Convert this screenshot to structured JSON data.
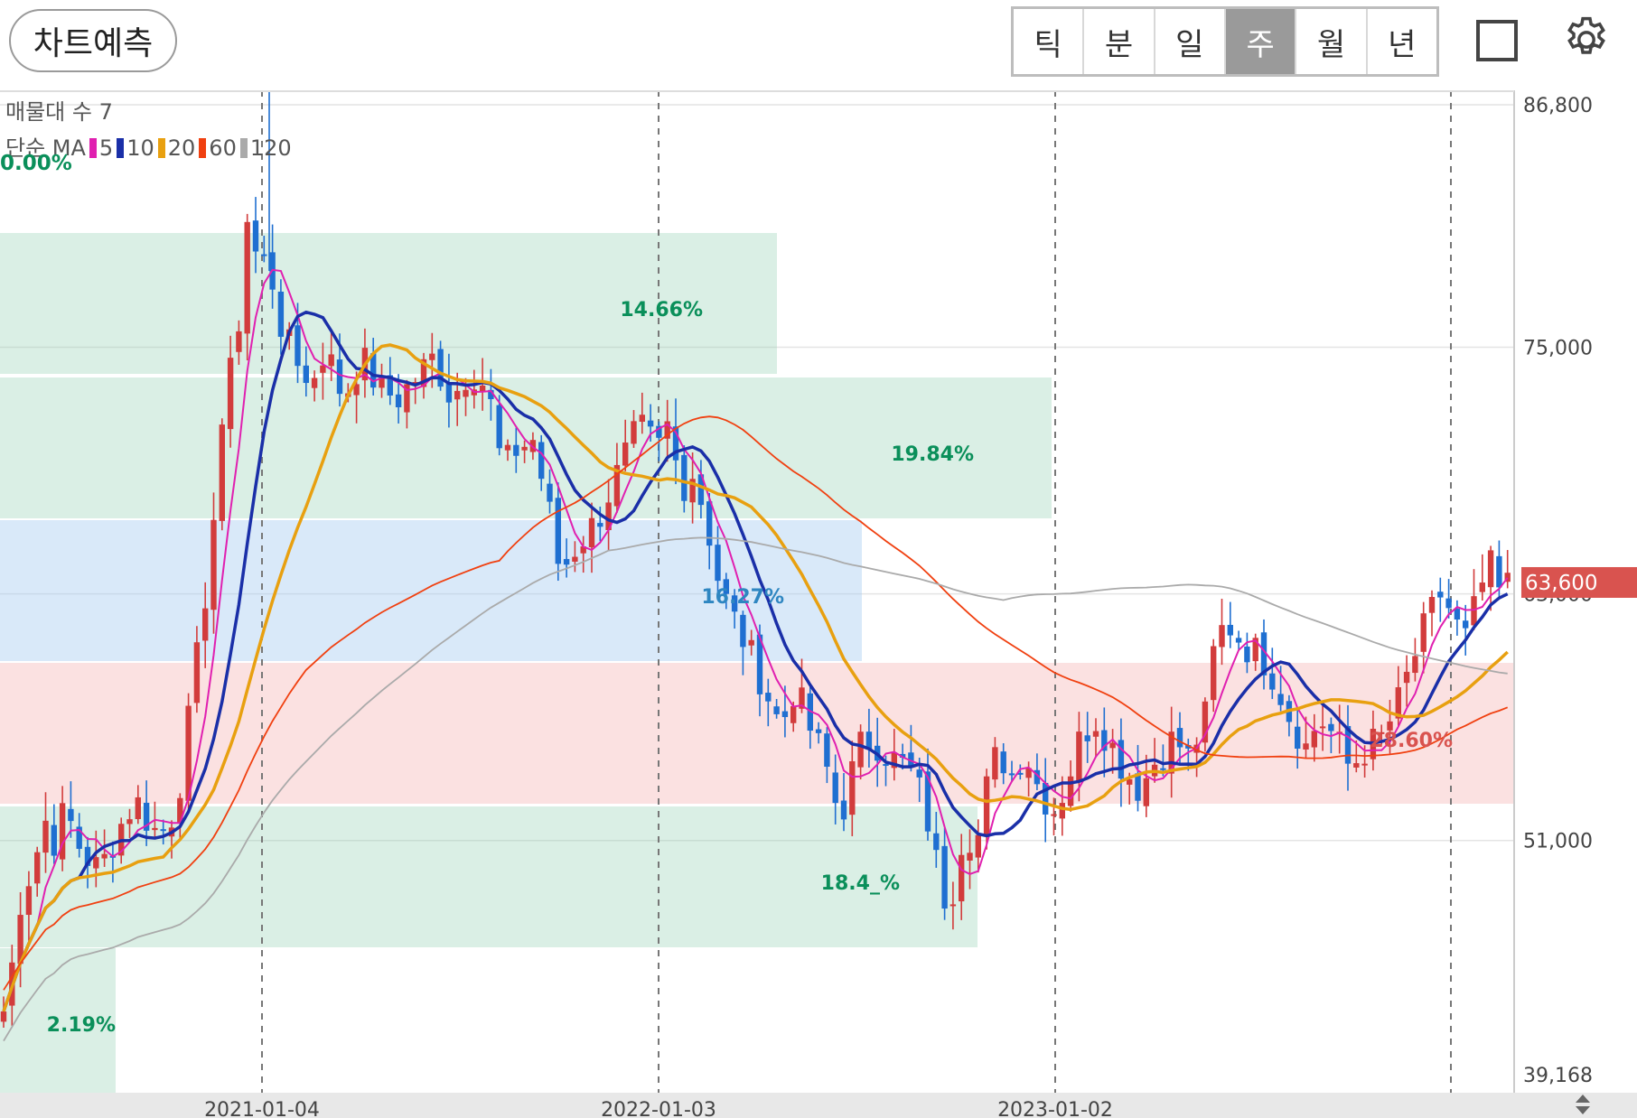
{
  "toolbar": {
    "forecast_label": "차트예측",
    "periods": [
      "틱",
      "분",
      "일",
      "주",
      "월",
      "년"
    ],
    "active_period": "주",
    "icons": [
      "square-icon",
      "gear-icon"
    ]
  },
  "legend": {
    "volume_profile": "매물대 수 7",
    "ma_label": "단순 MA",
    "ma_periods": [
      {
        "label": "5",
        "color": "#e020b0"
      },
      {
        "label": "10",
        "color": "#1a2fa8"
      },
      {
        "label": "20",
        "color": "#e8a010"
      },
      {
        "label": "60",
        "color": "#f04010"
      },
      {
        "label": "120",
        "color": "#aaaaaa"
      }
    ],
    "base_pct": "0.00%"
  },
  "axis": {
    "y_labels": [
      "86,800",
      "75,000",
      "63,000",
      "51,000",
      "39,168"
    ],
    "x_labels": [
      "2021-01-04",
      "2022-01-03",
      "2023-01-02"
    ],
    "current_price": "63,600",
    "current_price_color": "#d9534f"
  },
  "zones": [
    {
      "label": "14.66%",
      "color": "#0a8f5a"
    },
    {
      "label": "19.84%",
      "color": "#0a8f5a"
    },
    {
      "label": "16.27%",
      "color": "#2e86c1"
    },
    {
      "label": "28.60%",
      "color": "#d9534f"
    },
    {
      "label": "18.4_%",
      "color": "#0a8f5a"
    },
    {
      "label": "2.19%",
      "color": "#0a8f5a"
    }
  ],
  "chart_data": {
    "type": "candlestick",
    "y_range": [
      39168,
      86800
    ],
    "x_ticks": [
      "2021-01-04",
      "2022-01-03",
      "2023-01-02"
    ],
    "last_close": 63600,
    "moving_averages": [
      "5",
      "10",
      "20",
      "60",
      "120"
    ],
    "up_color": "#d23c3c",
    "down_color": "#1f6fd1"
  }
}
